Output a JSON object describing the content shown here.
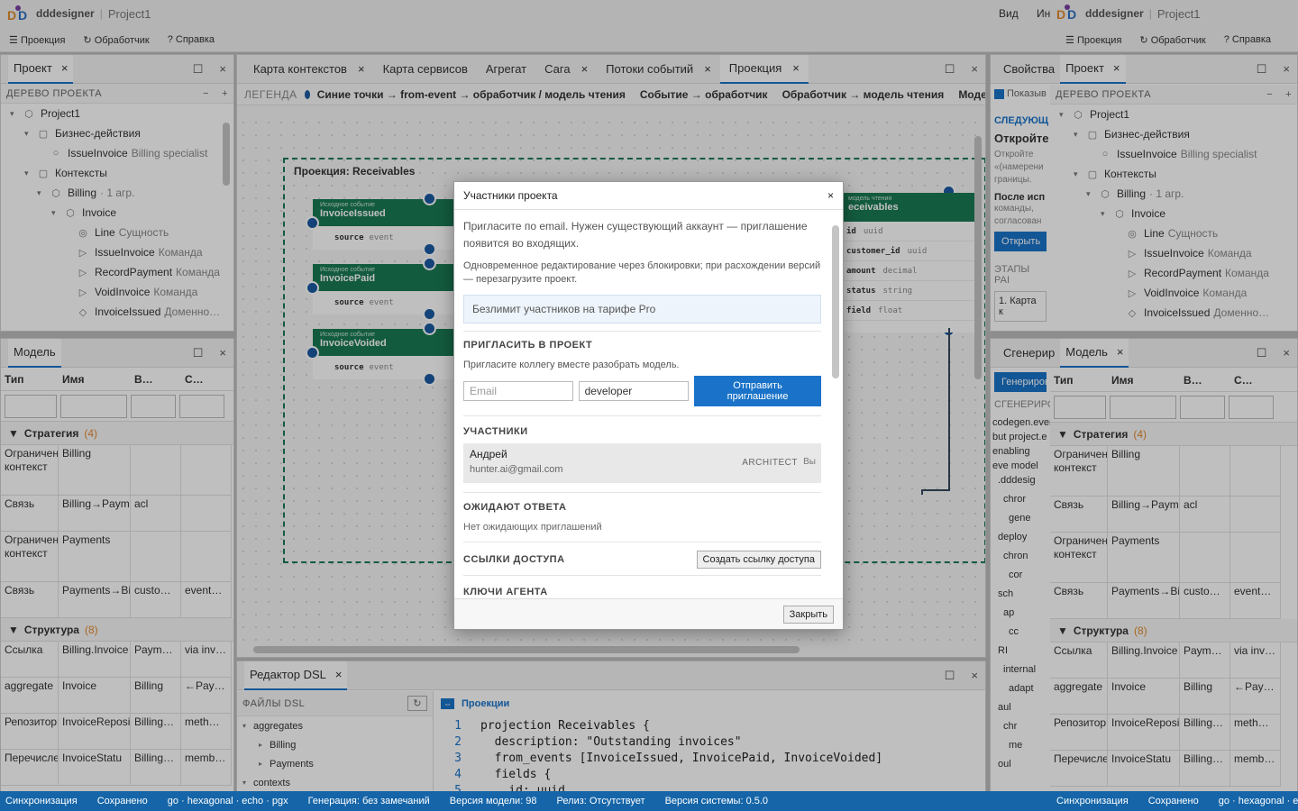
{
  "app": {
    "name": "dddesigner",
    "project": "Project1",
    "menu_view": "Вид",
    "menu_tools": "Ин"
  },
  "toolbar": {
    "projections": "Проекция",
    "handler": "Обработчик",
    "help": "Справка"
  },
  "project_panel": {
    "title": "Проект",
    "section": "ДЕРЕВО ПРОЕКТА",
    "tree": [
      {
        "label": "Project1",
        "muted": ""
      },
      {
        "label": "Бизнес-действия",
        "muted": ""
      },
      {
        "label": "IssueInvoice",
        "muted": "Billing specialist"
      },
      {
        "label": "Контексты",
        "muted": ""
      },
      {
        "label": "Billing",
        "muted": "· 1 агр."
      },
      {
        "label": "Invoice",
        "muted": ""
      },
      {
        "label": "Line",
        "muted": "Сущность"
      },
      {
        "label": "IssueInvoice",
        "muted": "Команда"
      },
      {
        "label": "RecordPayment",
        "muted": "Команда"
      },
      {
        "label": "VoidInvoice",
        "muted": "Команда"
      },
      {
        "label": "InvoiceIssued",
        "muted": "Доменно…"
      }
    ]
  },
  "model_panel": {
    "title": "Модель",
    "columns": [
      "Тип",
      "Имя",
      "В…",
      "С…"
    ],
    "strategy_label": "Стратегия",
    "strategy_count": "(4)",
    "strategy_rows": [
      [
        "Ограниченный контекст",
        "Billing",
        "",
        ""
      ],
      [
        "Связь",
        "Billing→Payments",
        "acl",
        ""
      ],
      [
        "Ограниченный контекст",
        "Payments",
        "",
        ""
      ],
      [
        "Связь",
        "Payments→Billing",
        "custo…",
        "event…"
      ]
    ],
    "structure_label": "Структура",
    "structure_count": "(8)",
    "structure_rows": [
      [
        "Ссылка",
        "Billing.Invoice",
        "Paym…",
        "via inv…"
      ],
      [
        "aggregate",
        "Invoice",
        "Billing",
        "←Pay…"
      ],
      [
        "Репозиторий",
        "InvoiceRepository",
        "Billing…",
        "meth…"
      ],
      [
        "Перечисление",
        "InvoiceStatu",
        "Billing…",
        "memb…"
      ]
    ]
  },
  "center_tabs": [
    "Карта контекстов",
    "Карта сервисов",
    "Агрегат",
    "Сага",
    "Потоки событий",
    "Проекция"
  ],
  "legend": {
    "label": "ЛЕГЕНДА",
    "item1": "Синие точки → from-event → обработчик / модель чтения",
    "item2": "Событие → обработчик",
    "item3": "Обработчик → модель чтения",
    "item4": "Моде"
  },
  "canvas": {
    "projection_title": "Проекция: Receivables",
    "events": [
      {
        "kind": "Исходное событие",
        "name": "InvoiceIssued",
        "field": "source",
        "type": "event"
      },
      {
        "kind": "Исходное событие",
        "name": "InvoicePaid",
        "field": "source",
        "type": "event"
      },
      {
        "kind": "Исходное событие",
        "name": "InvoiceVoided",
        "field": "source",
        "type": "event"
      }
    ],
    "readmodel": {
      "kind": "модель чтения",
      "name": "eceivables",
      "fields": [
        {
          "name": "id",
          "type": "uuid"
        },
        {
          "name": "customer_id",
          "type": "uuid"
        },
        {
          "name": "amount",
          "type": "decimal"
        },
        {
          "name": "status",
          "type": "string"
        },
        {
          "name": "field",
          "type": "float"
        }
      ]
    }
  },
  "dsl": {
    "title": "Редактор DSL",
    "files_label": "ФАЙЛЫ DSL",
    "tree": [
      "aggregates",
      "Billing",
      "Payments",
      "contexts"
    ],
    "tab": "Проекции",
    "lines": [
      {
        "n": "1",
        "t": "projection Receivables {"
      },
      {
        "n": "2",
        "t": "  description: \"Outstanding invoices\""
      },
      {
        "n": "3",
        "t": "  from_events [InvoiceIssued, InvoicePaid, InvoiceVoided]"
      },
      {
        "n": "4",
        "t": "  fields {"
      },
      {
        "n": "5",
        "t": "    id: uuid"
      }
    ]
  },
  "right": {
    "tab_props": "Свойства",
    "tab_project": "Проект",
    "show_label": "Показыв",
    "next_label": "СЛЕДУЮЩ",
    "open_title": "Откройте",
    "open_desc": "Откройте «(намерени границы.",
    "after_title": "После исп",
    "after_desc": "команды, согласован",
    "open_btn": "Открыть",
    "stages": "ЭТАПЫ РАІ",
    "stage1": "1. Карта к",
    "gen_tab": "Сгенерир",
    "gen_btn": "Генериров",
    "gen_label": "СГЕНЕРИРО",
    "gen_text": "codegen.events but project.e enabling eve model",
    "gen_tree": [
      ".dddesig",
      "chror",
      "gene",
      "deploy",
      "chron",
      "cor",
      "sch",
      "ap",
      "cc",
      "RI",
      "internal",
      "adapt",
      "aul",
      "chr",
      "me",
      "oul"
    ]
  },
  "modal": {
    "title": "Участники проекта",
    "intro": "Пригласите по email. Нужен существующий аккаунт — приглашение появится во входящих.",
    "locking": "Одновременное редактирование через блокировки; при расхождении версий — перезагрузите проект.",
    "pro": "Безлимит участников на тарифе Pro",
    "invite_title": "ПРИГЛАСИТЬ В ПРОЕКТ",
    "invite_hint": "Пригласите коллегу вместе разобрать модель.",
    "email_placeholder": "Email",
    "role_value": "developer",
    "send_btn": "Отправить приглашение",
    "members_title": "УЧАСТНИКИ",
    "member_name": "Андрей",
    "member_email": "hunter.ai@gmail.com",
    "member_role": "ARCHITECT",
    "member_you": "Вы",
    "pending_title": "ОЖИДАЮТ ОТВЕТА",
    "pending_empty": "Нет ожидающих приглашений",
    "links_title": "ССЫЛКИ ДОСТУПА",
    "links_btn": "Создать ссылку доступа",
    "keys_title": "КЛЮЧИ АГЕНТА",
    "close_btn": "Закрыть"
  },
  "status": [
    "Синхронизация",
    "Сохранено",
    "go · hexagonal · echo · pgx",
    "Генерация: без замечаний",
    "Версия модели: 98",
    "Релиз: Отсутствует",
    "Версия системы: 0.5.0"
  ],
  "status_right": [
    "Синхронизация",
    "Сохранено",
    "go · hexagonal · e"
  ],
  "colors": {
    "accent": "#1a73c8",
    "event": "#1a7a55",
    "status": "#1565a8"
  }
}
